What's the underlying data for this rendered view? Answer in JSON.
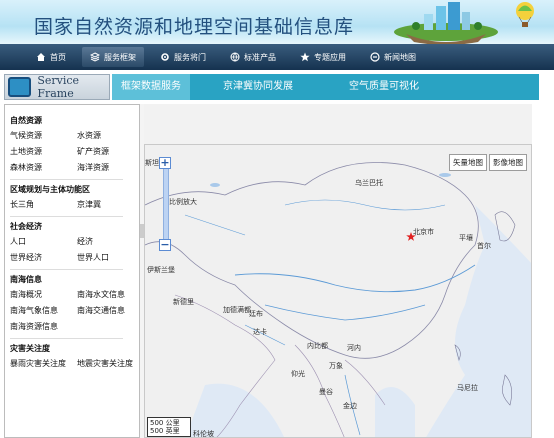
{
  "banner": {
    "title": "国家自然资源和地理空间基础信息库"
  },
  "nav": {
    "items": [
      {
        "label": "首页",
        "icon": "home-icon",
        "active": false
      },
      {
        "label": "服务框架",
        "icon": "layers-icon",
        "active": true
      },
      {
        "label": "服务将门",
        "icon": "gear-icon",
        "active": false
      },
      {
        "label": "标准产品",
        "icon": "globe-icon",
        "active": false
      },
      {
        "label": "专题应用",
        "icon": "star-icon",
        "active": false
      },
      {
        "label": "新闻地图",
        "icon": "news-icon",
        "active": false
      }
    ]
  },
  "subheader": {
    "logo_text": "Service Frame",
    "tabs": [
      {
        "label": "框架数据服务",
        "active": true
      },
      {
        "label": "京津冀协同发展",
        "active": false
      },
      {
        "label": "空气质量可视化",
        "active": false
      }
    ]
  },
  "sidebar": {
    "sections": [
      {
        "title": "自然资源",
        "items": [
          "气候资源",
          "水资源",
          "土地资源",
          "矿产资源",
          "森林资源",
          "海洋资源"
        ]
      },
      {
        "title": "区域规划与主体功能区",
        "items": [
          "长三角",
          "京津冀"
        ]
      },
      {
        "title": "社会经济",
        "items": [
          "人口",
          "经济",
          "世界经济",
          "世界人口"
        ]
      },
      {
        "title": "南海信息",
        "items": [
          "南海概况",
          "南海水文信息",
          "南海气象信息",
          "南海交通信息",
          "南海资源信息"
        ]
      },
      {
        "title": "灾害关注度",
        "items": [
          "暴雨灾害关注度",
          "地震灾害关注度"
        ]
      }
    ]
  },
  "map": {
    "buttons": [
      "矢量地图",
      "影像地图"
    ],
    "zoom_label": "比例放大",
    "labels": {
      "tajikistan": "斯坦",
      "ulaanbaatar": "乌兰巴托",
      "beijing": "北京市",
      "pyongyang": "平壤",
      "seoul": "首尔",
      "islamabad": "伊斯兰堡",
      "newdelhi": "新德里",
      "kathmandu": "加德满都",
      "thimphu": "廷布",
      "dhaka": "达卡",
      "naypyidaw": "内比都",
      "hanoi": "河内",
      "vientiane": "万象",
      "yangon": "仰光",
      "bangkok": "曼谷",
      "phnompenh": "金边",
      "manila": "马尼拉",
      "colombo": "科伦坡"
    },
    "scale_text": "500 公里",
    "scale_text2": "500 英里"
  },
  "colors": {
    "nav_bg": "#15324f",
    "tab_bg": "#29a3c3",
    "tab_active": "#5dc0d9",
    "capital_star": "#e02020",
    "water": "#5b9ad6"
  }
}
